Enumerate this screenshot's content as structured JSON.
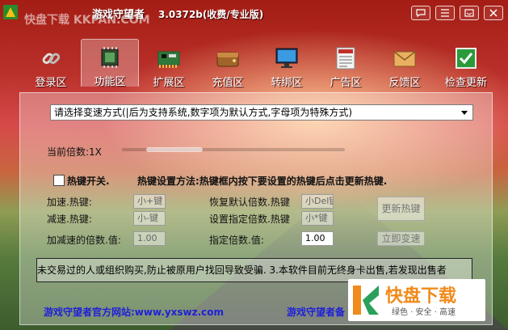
{
  "window": {
    "title": "游戏守望者",
    "version": "3.0372b(收费/专业版)",
    "overlay_site": "快盘下载 KKPAN.COM",
    "controls": [
      "skin-icon",
      "menu-icon",
      "minimize-icon",
      "close-icon"
    ]
  },
  "toolbar": {
    "tabs": [
      {
        "label": "登录区",
        "icon": "chain-link-icon"
      },
      {
        "label": "功能区",
        "icon": "chip-icon",
        "active": true
      },
      {
        "label": "扩展区",
        "icon": "circuit-board-icon"
      },
      {
        "label": "充值区",
        "icon": "wallet-icon"
      },
      {
        "label": "转绑区",
        "icon": "monitor-icon"
      },
      {
        "label": "广告区",
        "icon": "news-icon"
      },
      {
        "label": "反馈区",
        "icon": "mail-icon"
      },
      {
        "label": "检查更新",
        "icon": "check-box-icon"
      }
    ]
  },
  "panel": {
    "speed_mode_select": "请选择变速方式(|后为支持系统,数字项为默认方式,字母项为特殊方式)",
    "current_multiplier_label": "当前倍数:1X",
    "current_multiplier": 1,
    "hotkey_switch_label": "热键开关.",
    "hotkey_help": "热键设置方法:热键框内按下要设置的热键后点击更新热键.",
    "speed_up_label": "加速.热键:",
    "speed_up_value": "小+键",
    "slow_down_label": "减速.热键:",
    "slow_down_value": "小-键",
    "restore_label": "恢复默认倍数.热键",
    "restore_value": "小Del键",
    "set_multiplier_hotkey_label": "设置指定倍数.热键",
    "set_multiplier_hotkey_value": "小*键",
    "accel_step_label": "加减速的倍数.值:",
    "accel_step_value": "1.00",
    "target_multiplier_label": "指定倍数.值:",
    "target_multiplier_value": "1.00",
    "update_hotkey_button": "更新热键",
    "apply_speed_button": "立即变速",
    "ticker": "未交易过的人或组织购买,防止被原用户找回导致受骗.       3.本软件目前无终身卡出售,若发现出售者",
    "official_site": "游戏守望者官方网站:www.yxswz.com",
    "footer_right": "游戏守望者备"
  },
  "watermark": {
    "brand": "快盘下载",
    "tagline": "绿色 · 安全 · 高速"
  }
}
